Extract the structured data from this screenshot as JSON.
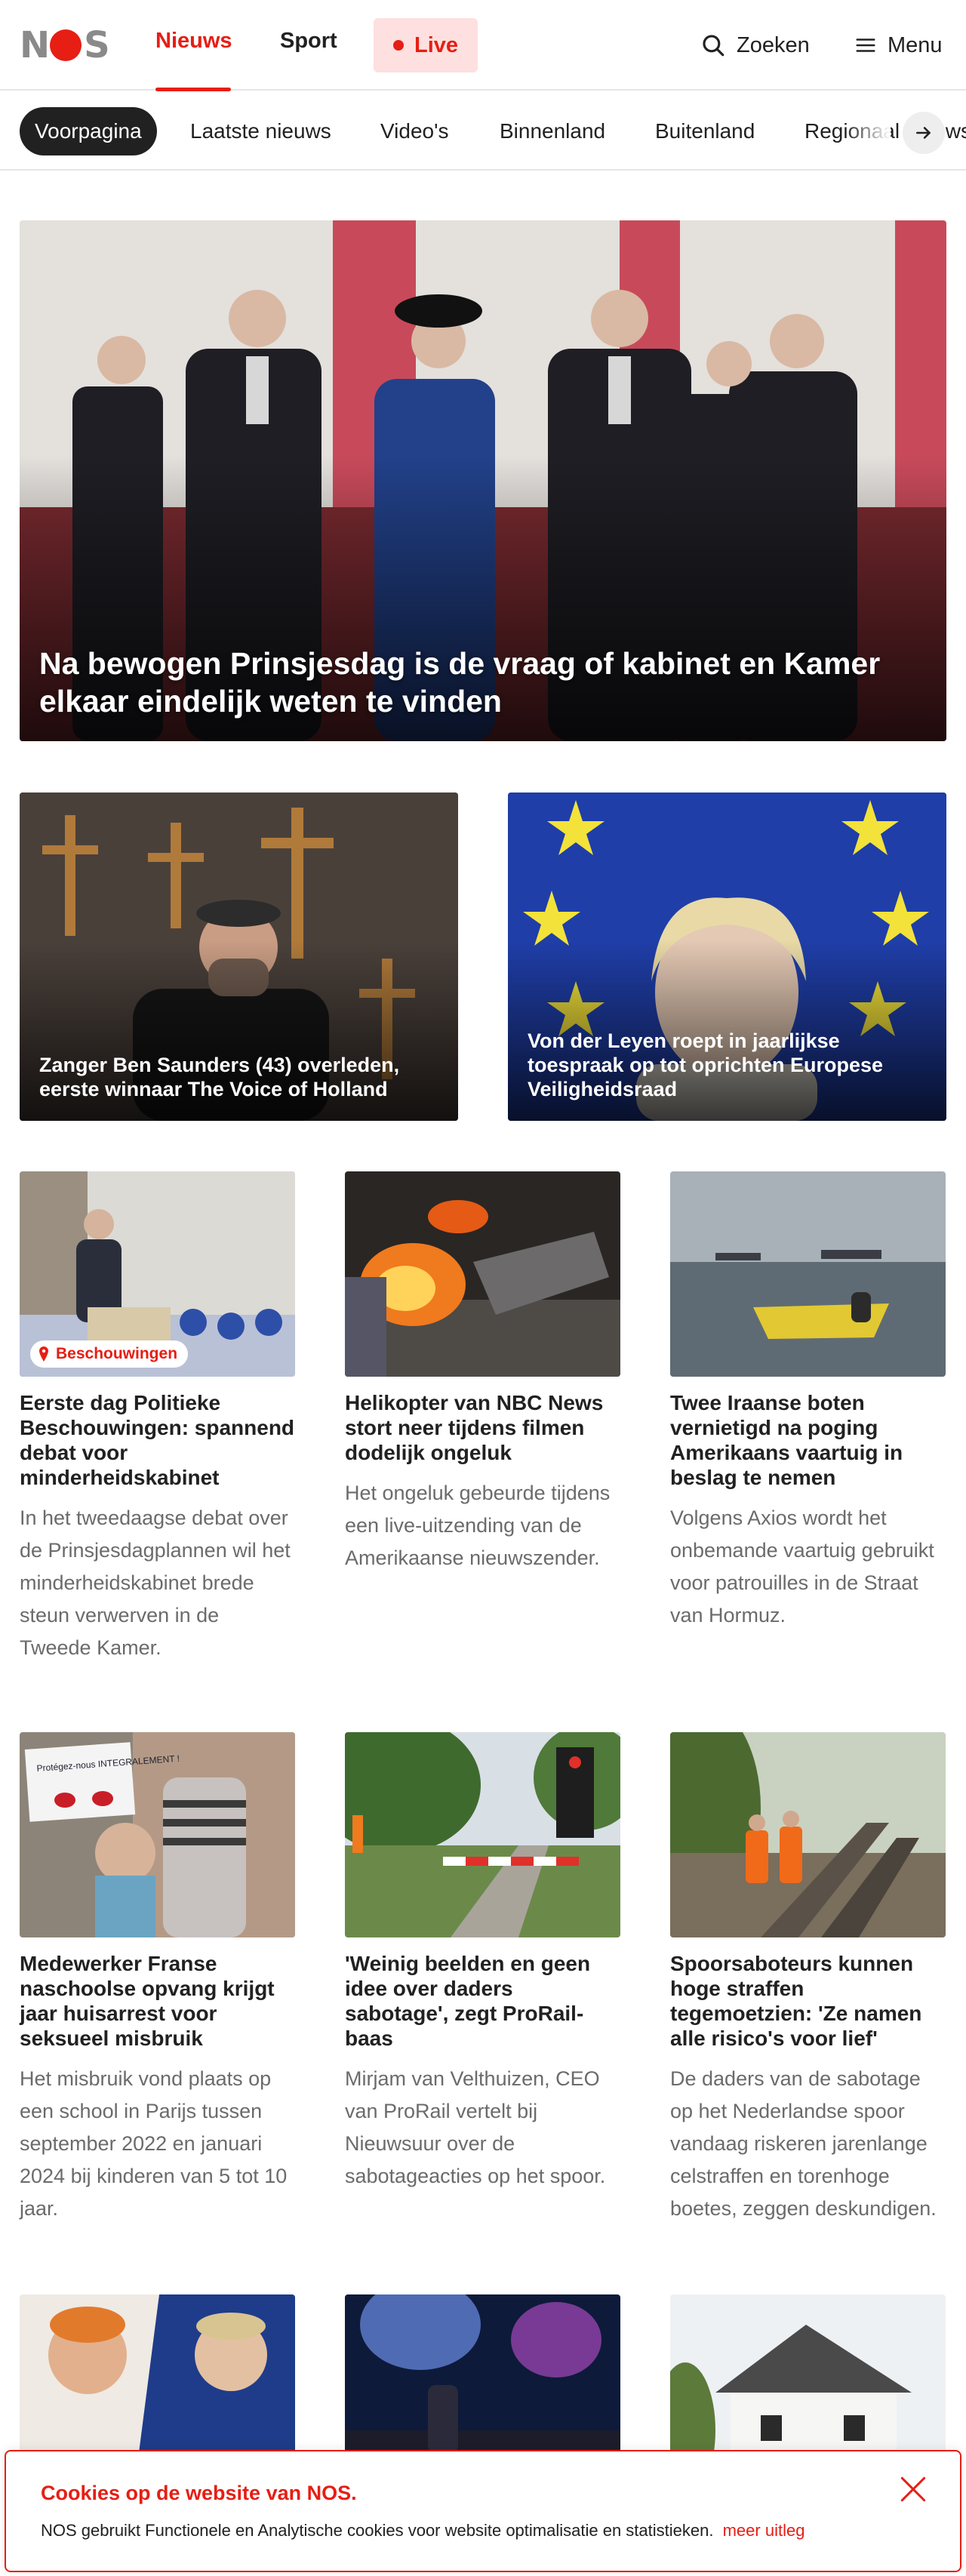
{
  "header": {
    "logo_text": "NOS",
    "nav": {
      "news": "Nieuws",
      "sport": "Sport",
      "live": "Live"
    },
    "search_label": "Zoeken",
    "menu_label": "Menu"
  },
  "tabs": [
    "Voorpagina",
    "Laatste nieuws",
    "Video's",
    "Binnenland",
    "Buitenland",
    "Regionaal nieuws"
  ],
  "hero": {
    "title": "Na bewogen Prinsjesdag is de vraag of kabinet en Kamer elkaar eindelijk weten te vinden"
  },
  "featured": [
    {
      "title": "Zanger Ben Saunders (43) overleden, eerste winnaar The Voice of Holland"
    },
    {
      "title": "Von der Leyen roept in jaarlijkse toespraak op tot oprichten Europese Veiligheidsraad"
    }
  ],
  "articles": [
    {
      "tag": "Beschouwingen",
      "title": "Eerste dag Politieke Beschouwingen: spannend debat voor minderheidskabinet",
      "desc": "In het tweedaagse debat over de Prinsjesdagplannen wil het minderheidskabinet brede steun verwerven in de Tweede Kamer."
    },
    {
      "title": "Helikopter van NBC News stort neer tijdens filmen dodelijk ongeluk",
      "desc": "Het ongeluk gebeurde tijdens een live-uitzending van de Amerikaanse nieuwszender."
    },
    {
      "title": "Twee Iraanse boten vernietigd na poging Amerikaans vaartuig in beslag te nemen",
      "desc": "Volgens Axios wordt het onbemande vaartuig gebruikt voor patrouilles in de Straat van Hormuz."
    },
    {
      "title": "Medewerker Franse naschoolse opvang krijgt jaar huisarrest voor seksueel misbruik",
      "desc": "Het misbruik vond plaats op een school in Parijs tussen september 2022 en januari 2024 bij kinderen van 5 tot 10 jaar."
    },
    {
      "title": "'Weinig beelden en geen idee over daders sabotage', zegt ProRail-baas",
      "desc": "Mirjam van Velthuizen, CEO van ProRail vertelt bij Nieuwsuur over de sabotageacties op het spoor."
    },
    {
      "title": "Spoorsaboteurs kunnen hoge straffen tegemoetzien: 'Ze namen alle risico's voor lief'",
      "desc": "De daders van de sabotage op het Nederlandse spoor vandaag riskeren jarenlange celstraffen en torenhoge boetes, zeggen deskundigen."
    }
  ],
  "photo_sign_text": "Protégez-nous INTEGRALEMENT !",
  "cookie": {
    "title": "Cookies op de website van NOS.",
    "text": "NOS gebruikt Functionele en Analytische cookies voor website optimalisatie en statistieken.",
    "link": "meer uitleg"
  },
  "colors": {
    "brand_red": "#e61e14",
    "text": "#212121",
    "muted": "#6b6b6b"
  }
}
